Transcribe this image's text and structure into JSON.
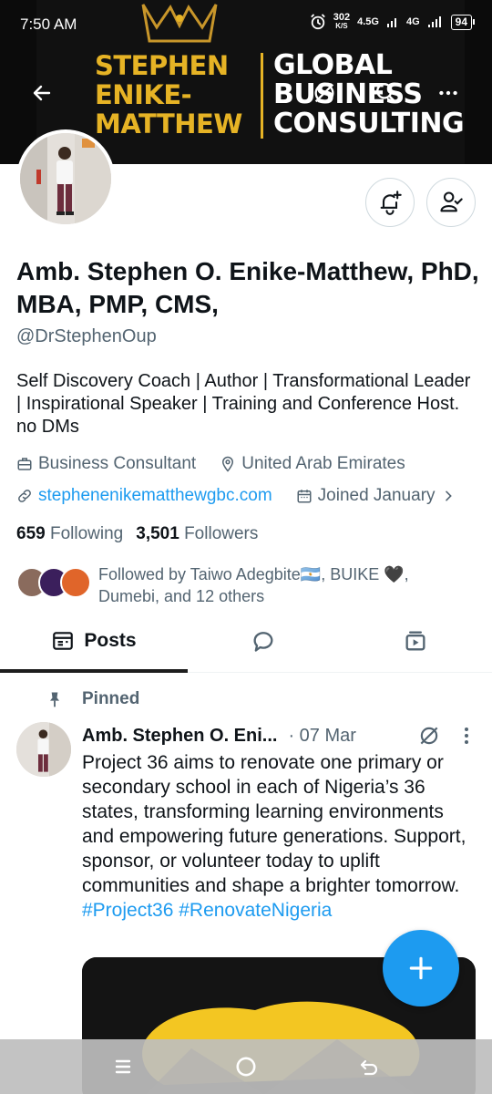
{
  "status_bar": {
    "time": "7:50 AM",
    "net_speed_value": "302",
    "net_speed_unit": "K/S",
    "network_type_1": "4.5G",
    "network_type_2": "4G",
    "battery": "94"
  },
  "banner": {
    "left_text": [
      "STEPHEN",
      "ENIKE-",
      "MATTHEW"
    ],
    "right_text": [
      "GLOBAL",
      "BUSINESS",
      "CONSULTING"
    ],
    "colors": {
      "gold": "#e6b325",
      "background": "#0b0b0b"
    }
  },
  "profile": {
    "name": "Amb. Stephen O. Enike-Matthew, PhD, MBA, PMP, CMS,",
    "handle": "@DrStephenOup",
    "bio": "Self Discovery Coach | Author | Transformational Leader | Inspirational Speaker | Training and Conference Host. no DMs",
    "profession": "Business Consultant",
    "location": "United Arab Emirates",
    "website": "stephenenikematthewgbc.com",
    "joined": "Joined January",
    "following_count": "659",
    "following_label": "Following",
    "followers_count": "3,501",
    "followers_label": "Followers",
    "followed_by": "Followed by Taiwo Adegbite🇦🇷, BUIKE 🖤, Dumebi, and 12 others"
  },
  "tabs": {
    "posts": "Posts",
    "replies_icon": "speech-bubble-icon",
    "media_icon": "video-stack-icon"
  },
  "tweet": {
    "pinned_label": "Pinned",
    "author": "Amb. Stephen O. Eni...",
    "date": "· 07 Mar",
    "text": "Project 36 aims to renovate one primary or secondary school in each of Nigeria’s 36 states, transforming learning environments and empowering future generations. Support, sponsor, or volunteer today to uplift communities and shape a brighter tomorrow.",
    "hashtags": "#Project36 #RenovateNigeria"
  },
  "colors": {
    "accent": "#1d9bf0",
    "text": "#0f1419",
    "secondary_text": "#536471"
  }
}
